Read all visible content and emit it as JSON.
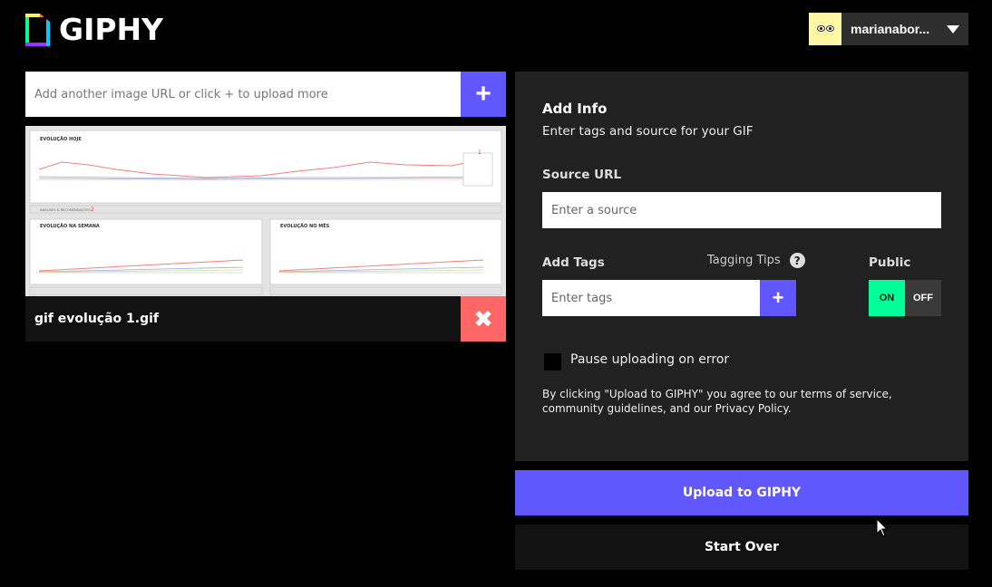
{
  "colors": {
    "accent": "#6157ff",
    "danger": "#ff6666",
    "toggle_on": "#00ff99",
    "panel": "#212121",
    "background": "#000000"
  },
  "header": {
    "logo_text": "GIPHY",
    "username": "marianabor..."
  },
  "upload": {
    "url_placeholder": "Add another image URL or click + to upload more",
    "add_icon": "+"
  },
  "gif": {
    "file_name": "gif evolução 1.gif",
    "remove_icon": "✖",
    "preview": {
      "top_title": "EVOLUÇÃO HOJE",
      "bottom_left_title": "EVOLUÇÃO NA SEMANA",
      "bottom_right_title": "EVOLUÇÃO NO MÊS",
      "section_label": "ANÁLISES & RECOMENDAÇÕES",
      "marker_1": "1",
      "marker_2": "2"
    }
  },
  "info": {
    "title": "Add Info",
    "subtitle": "Enter tags and source for your GIF",
    "source_label": "Source URL",
    "source_placeholder": "Enter a source",
    "tags_label": "Add Tags",
    "tagging_tips": "Tagging Tips",
    "help_icon": "?",
    "tags_placeholder": "Enter tags",
    "tags_add_icon": "+",
    "public_label": "Public",
    "toggle_on": "ON",
    "toggle_off": "OFF",
    "pause_label": "Pause uploading on error",
    "terms": "By clicking \"Upload to GIPHY\" you agree to our terms of service, community guidelines, and our Privacy Policy."
  },
  "actions": {
    "upload_label": "Upload to GIPHY",
    "start_over_label": "Start Over"
  }
}
